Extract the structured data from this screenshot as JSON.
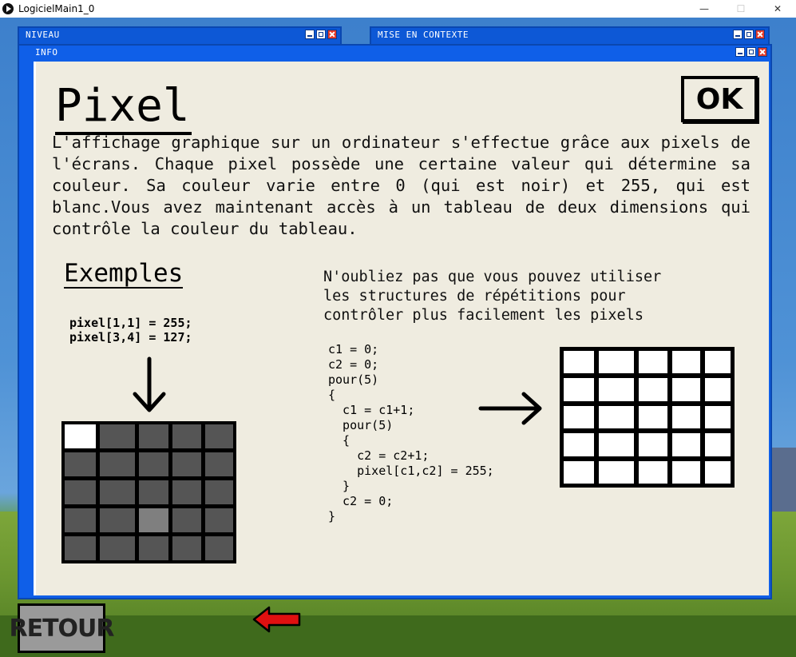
{
  "app": {
    "title": "LogicielMain1_0"
  },
  "window_controls": {
    "minimize": "—",
    "maximize": "☐",
    "close": "✕"
  },
  "panels": {
    "niveau": {
      "title": "NIVEAU"
    },
    "contexte": {
      "title": "MISE EN CONTEXTE"
    },
    "info": {
      "title": "INFO"
    }
  },
  "info": {
    "heading": "Pixel",
    "ok_label": "OK",
    "paragraph": "L'affichage graphique sur un ordinateur s'effectue grâce aux pixels de l'écrans. Chaque pixel possède une certaine valeur qui détermine sa couleur. Sa couleur varie entre 0 (qui est noir) et 255, qui est blanc.Vous avez maintenant accès à un tableau de deux dimensions qui contrôle la couleur du tableau.",
    "examples_title": "Exemples",
    "example_code": "pixel[1,1] = 255;\npixel[3,4] = 127;",
    "note": "N'oubliez pas que vous pouvez utiliser\nles structures de répétitions pour\ncontrôler plus facilement les pixels",
    "loop_code": "c1 = 0;\nc2 = 0;\npour(5)\n{\n  c1 = c1+1;\n  pour(5)\n  {\n    c2 = c2+1;\n    pixel[c1,c2] = 255;\n  }\n  c2 = 0;\n}",
    "grid_before": [
      [
        255,
        85,
        85,
        85,
        85
      ],
      [
        85,
        85,
        85,
        85,
        85
      ],
      [
        85,
        85,
        85,
        85,
        85
      ],
      [
        85,
        85,
        127,
        85,
        85
      ],
      [
        85,
        85,
        85,
        85,
        85
      ]
    ],
    "grid_after": [
      [
        255,
        255,
        255,
        255,
        255
      ],
      [
        255,
        255,
        255,
        255,
        255
      ],
      [
        255,
        255,
        255,
        255,
        255
      ],
      [
        255,
        255,
        255,
        255,
        255
      ],
      [
        255,
        255,
        255,
        255,
        255
      ]
    ]
  },
  "footer": {
    "retour_label": "RETOUR"
  },
  "icons": {
    "app": "play-circle-icon",
    "down_arrow": "down-arrow-icon",
    "right_arrow": "right-arrow-icon",
    "back_arrow": "red-left-arrow-icon"
  },
  "colors": {
    "window_blue": "#0f5fe8",
    "content_bg": "#efece0",
    "arrow_red": "#e01010",
    "button_gray": "#9a9a9a"
  }
}
